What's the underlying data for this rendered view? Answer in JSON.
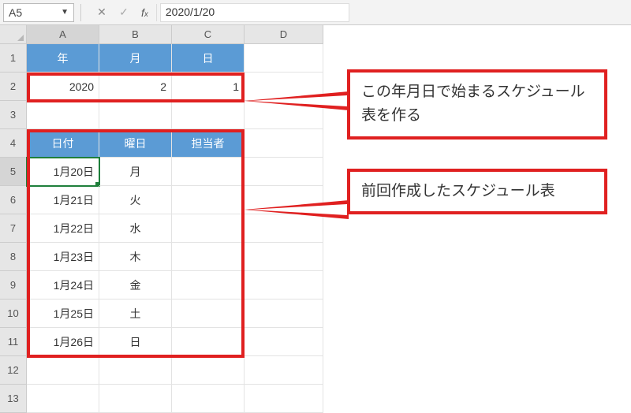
{
  "namebox": "A5",
  "formula_bar": "2020/1/20",
  "columns": [
    "A",
    "B",
    "C",
    "D"
  ],
  "row_numbers": [
    "1",
    "2",
    "3",
    "4",
    "5",
    "6",
    "7",
    "8",
    "9",
    "10",
    "11",
    "12",
    "13"
  ],
  "hdr1": {
    "col1": "年",
    "col2": "月",
    "col3": "日"
  },
  "row2": {
    "year": "2020",
    "month": "2",
    "day": "1"
  },
  "hdr2": {
    "col1": "日付",
    "col2": "曜日",
    "col3": "担当者"
  },
  "schedule": [
    {
      "date": "1月20日",
      "dow": "月"
    },
    {
      "date": "1月21日",
      "dow": "火"
    },
    {
      "date": "1月22日",
      "dow": "水"
    },
    {
      "date": "1月23日",
      "dow": "木"
    },
    {
      "date": "1月24日",
      "dow": "金"
    },
    {
      "date": "1月25日",
      "dow": "土"
    },
    {
      "date": "1月26日",
      "dow": "日"
    }
  ],
  "callout1": "この年月日で始まるスケジュール表を作る",
  "callout2": "前回作成したスケジュール表",
  "selected_cell": "A5"
}
